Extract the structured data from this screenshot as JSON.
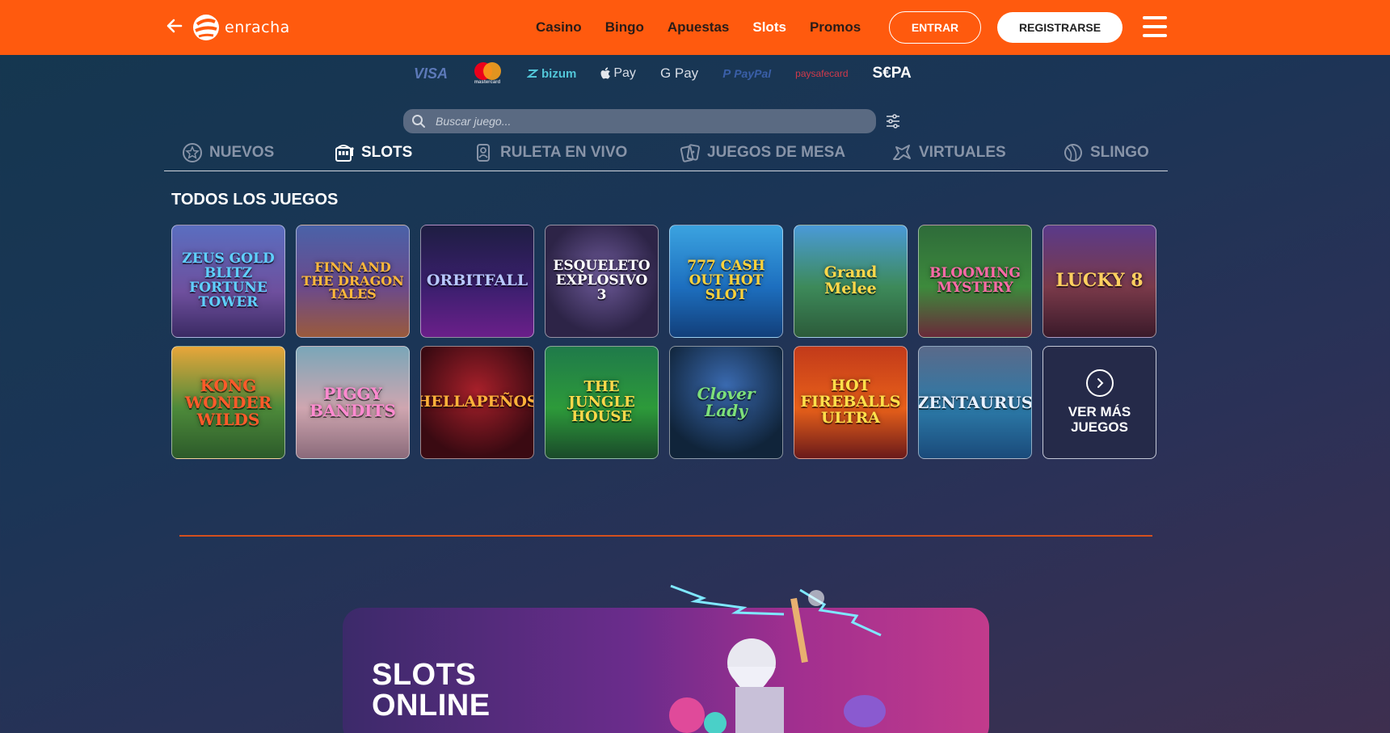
{
  "header": {
    "logo_text": "enracha",
    "nav": [
      "Casino",
      "Bingo",
      "Apuestas",
      "Slots",
      "Promos"
    ],
    "active_nav": "Slots",
    "login_label": "ENTRAR",
    "register_label": "REGISTRARSE",
    "brand_color": "#ff5a0e"
  },
  "payments": {
    "visa": "VISA",
    "mastercard": "mastercard",
    "bizum": "bizum",
    "applepay": "Pay",
    "googlepay": "G Pay",
    "paypal": "PayPal",
    "paysafecard": "paysafecard",
    "sepa": "S€PA"
  },
  "search": {
    "placeholder": "Buscar juego..."
  },
  "categories": [
    {
      "label": "NUEVOS",
      "icon": "star-badge-icon"
    },
    {
      "label": "SLOTS",
      "icon": "slot-machine-icon",
      "active": true
    },
    {
      "label": "RULETA EN VIVO",
      "icon": "live-dealer-icon"
    },
    {
      "label": "JUEGOS DE MESA",
      "icon": "cards-icon"
    },
    {
      "label": "VIRTUALES",
      "icon": "horse-icon"
    },
    {
      "label": "SLINGO",
      "icon": "ball-icon"
    }
  ],
  "section_title": "TODOS LOS JUEGOS",
  "games": [
    "ZEUS GOLD BLITZ FORTUNE TOWER",
    "FINN AND THE DRAGON TALES",
    "ORBITFALL",
    "ESQUELETO EXPLOSIVO 3",
    "777 CASH OUT HOT SLOT",
    "Grand Melee",
    "BLOOMING MYSTERY",
    "LUCKY 8",
    "KONG WONDER WILDS",
    "PIGGY BANDITS",
    "HELLAPEÑOS",
    "THE JUNGLE HOUSE",
    "Clover Lady",
    "HOT FIREBALLS ULTRA",
    "ZENTAURUS"
  ],
  "more_games_label": "VER MÁS JUEGOS",
  "banner": {
    "title_line1": "SLOTS",
    "title_line2": "ONLINE"
  }
}
